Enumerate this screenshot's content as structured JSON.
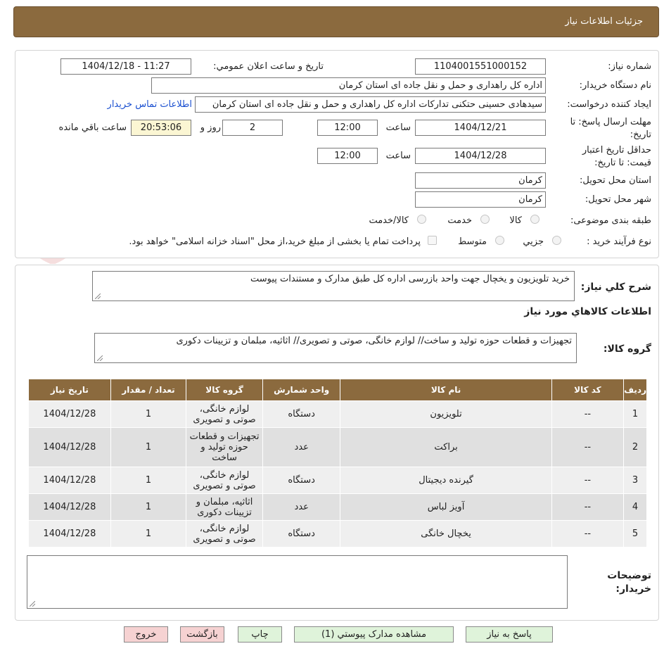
{
  "header": {
    "title": "جزئیات اطلاعات نیاز"
  },
  "form": {
    "need_number_label": "شماره نیاز:",
    "need_number": "1104001551000152",
    "announce_label": "تاریخ و ساعت اعلان عمومي:",
    "announce_value": "1404/12/18 - 11:27",
    "buyer_org_label": "نام دستگاه خریدار:",
    "buyer_org": "اداره کل راهداری و حمل و نقل جاده ای استان کرمان",
    "requester_label": "ایجاد کننده درخواست:",
    "requester": "سیدهادی حسینی حتکنی تدارکات اداره کل راهداری و حمل و نقل جاده ای استان کرمان",
    "contact_link": "اطلاعات تماس خریدار",
    "reply_deadline_label_1": "مهلت ارسال پاسخ: تا",
    "reply_deadline_label_2": "تاریخ:",
    "reply_date": "1404/12/21",
    "time_label": "ساعت",
    "reply_time": "12:00",
    "days": "2",
    "days_label": "روز و",
    "remaining_time": "20:53:06",
    "remaining_label": "ساعت باقي مانده",
    "validity_label_1": "حداقل تاریخ اعتبار",
    "validity_label_2": "قیمت: تا تاریخ:",
    "validity_date": "1404/12/28",
    "validity_time_label": "ساعت",
    "validity_time": "12:00",
    "province_label": "استان محل تحویل:",
    "province": "کرمان",
    "city_label": "شهر محل تحویل:",
    "city": "کرمان",
    "category_label": "طبقه بندی موضوعی:",
    "category_options": [
      "کالا",
      "خدمت",
      "کالا/خدمت"
    ],
    "process_label": "نوع فرآیند خرید :",
    "process_options": [
      "جزیي",
      "متوسط"
    ],
    "payment_note": "پرداخت تمام یا بخشی از مبلغ خرید،از محل \"اسناد خزانه اسلامی\" خواهد بود."
  },
  "summary": {
    "desc_label": "شرح کلي نیاز:",
    "desc": "خرید تلویزیون و یخچال جهت واحد بازرسی اداره کل طبق مدارک و مستندات پیوست",
    "items_title": "اطلاعات کالاهاي مورد نیاز",
    "group_label": "گروه کالا:",
    "group": "تجهیزات و قطعات حوزه تولید و ساخت// لوازم خانگی، صوتی و تصویری// اثاثیه، مبلمان و تزیینات دکوری"
  },
  "table": {
    "headers": [
      "ردیف",
      "کد کالا",
      "نام کالا",
      "واحد شمارش",
      "گروه کالا",
      "تعداد / مقدار",
      "تاریخ نیاز"
    ],
    "rows": [
      [
        "1",
        "--",
        "تلویزیون",
        "دستگاه",
        "لوازم خانگی، صوتی و تصویری",
        "1",
        "1404/12/28"
      ],
      [
        "2",
        "--",
        "براکت",
        "عدد",
        "تجهیزات و قطعات حوزه تولید و ساخت",
        "1",
        "1404/12/28"
      ],
      [
        "3",
        "--",
        "گیرنده دیجیتال",
        "دستگاه",
        "لوازم خانگی، صوتی و تصویری",
        "1",
        "1404/12/28"
      ],
      [
        "4",
        "--",
        "آویز لباس",
        "عدد",
        "اثاثیه، مبلمان و تزیینات دکوری",
        "1",
        "1404/12/28"
      ],
      [
        "5",
        "--",
        "یخچال خانگی",
        "دستگاه",
        "لوازم خانگی، صوتی و تصویری",
        "1",
        "1404/12/28"
      ]
    ]
  },
  "notes": {
    "label_1": "توضیحات",
    "label_2": "خریدار:",
    "value": ""
  },
  "buttons": {
    "reply": "پاسخ به نیاز",
    "view_docs": "مشاهده مدارک پیوستي (1)",
    "print": "چاپ",
    "back": "بازگشت",
    "exit": "خروج"
  },
  "watermark": {
    "text": "AriaTender.neT"
  },
  "colors": {
    "header_bg": "#8b6a3e",
    "link": "#1a4fd0",
    "green_button": "#dff3da",
    "pink_button": "#f6d2d2",
    "remaining_bg": "#fbf6d3"
  }
}
